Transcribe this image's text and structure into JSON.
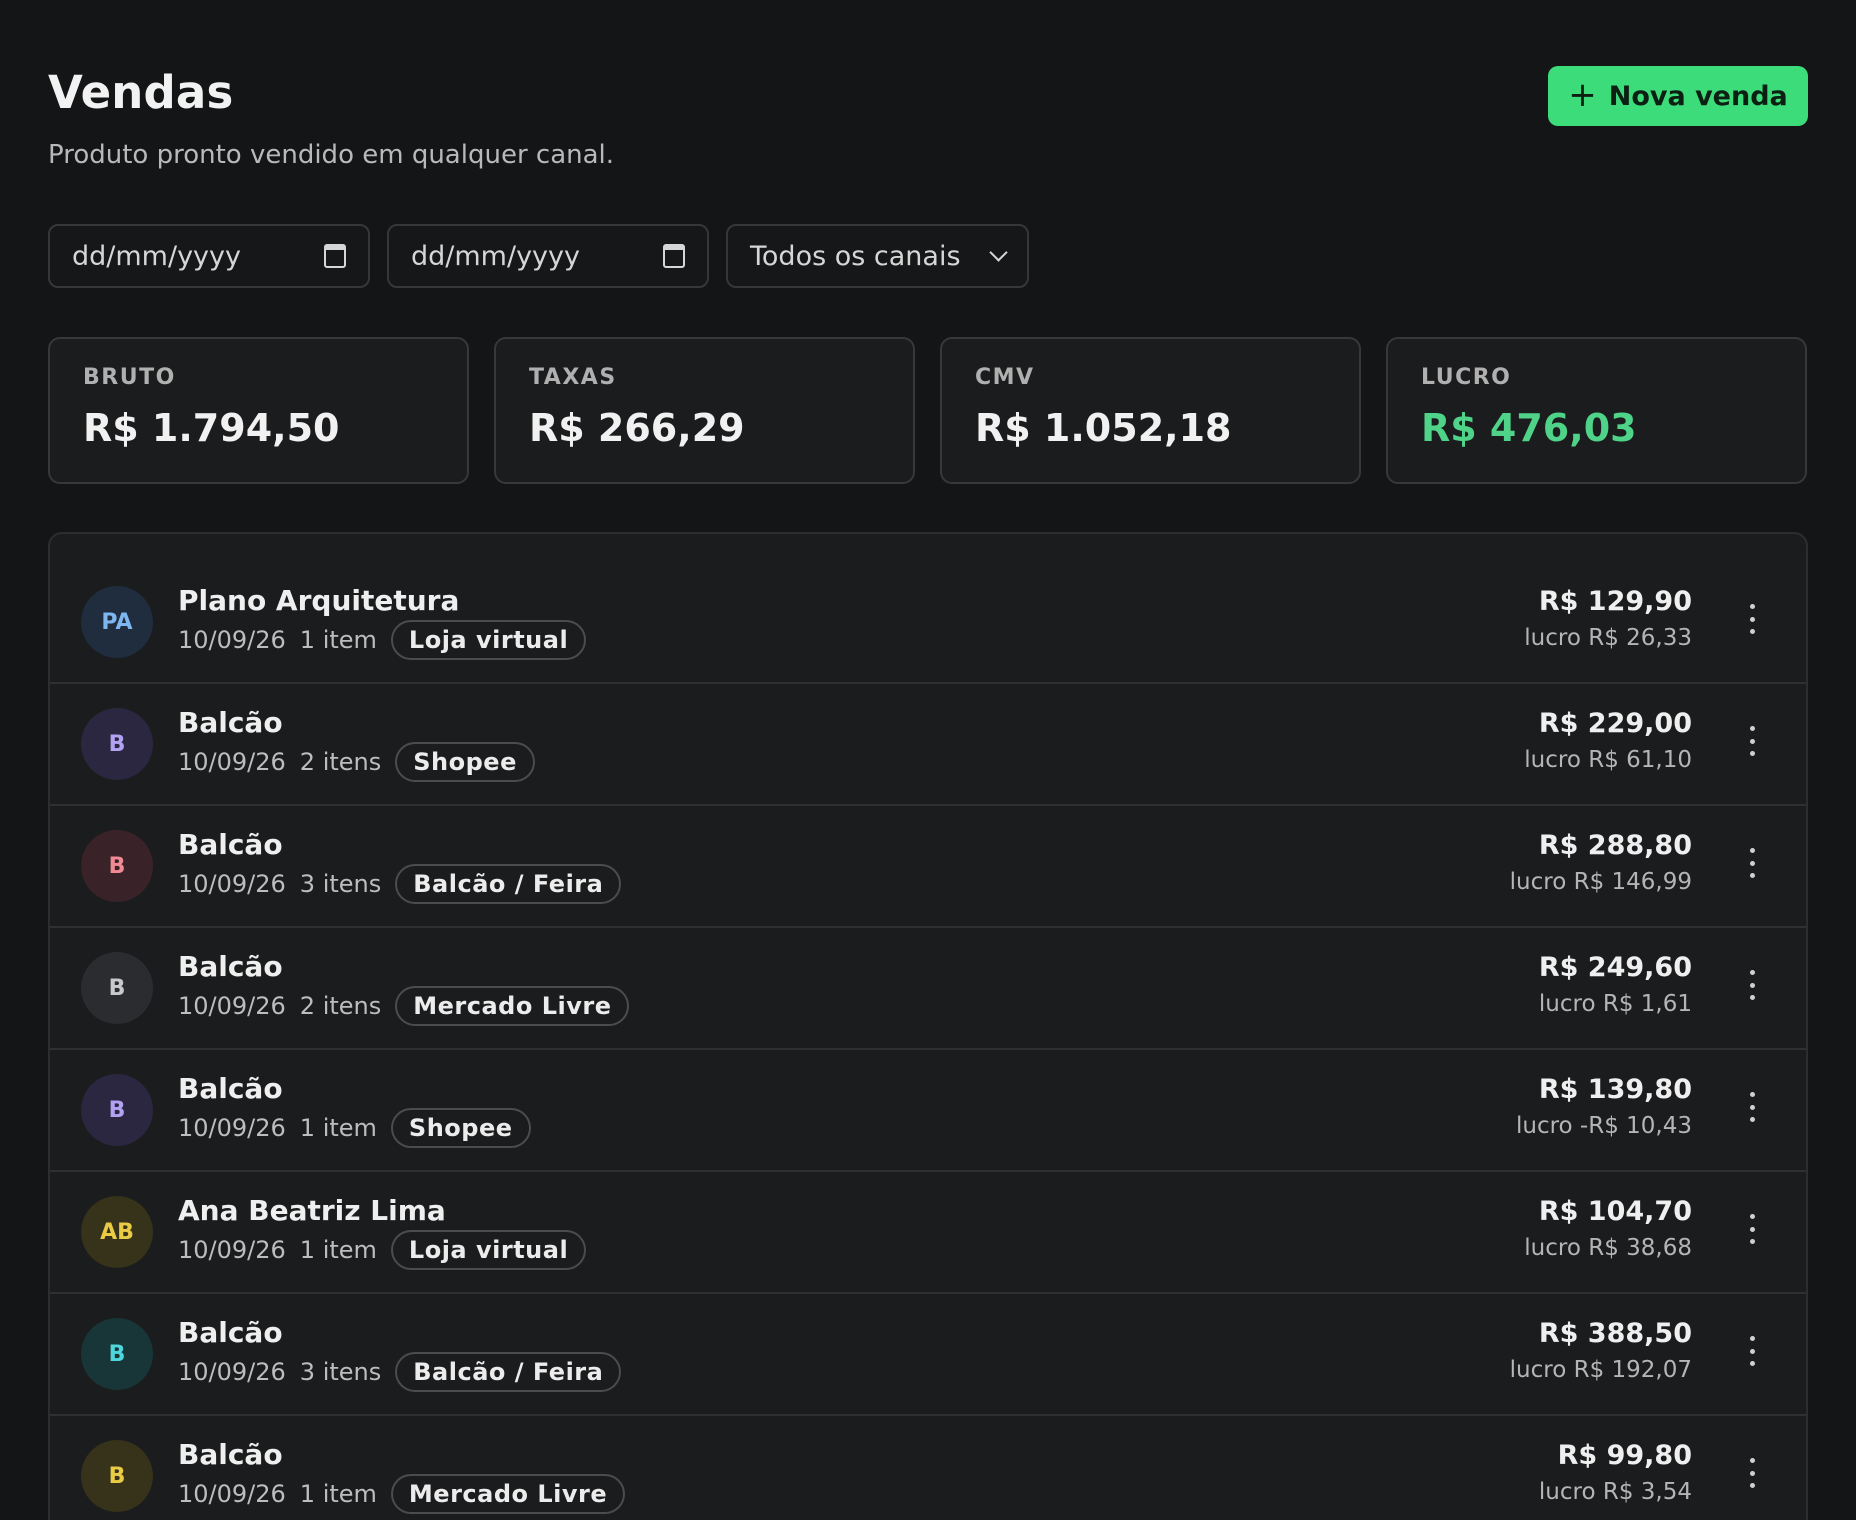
{
  "header": {
    "title": "Vendas",
    "subtitle": "Produto pronto vendido em qualquer canal.",
    "new_button_icon": "+",
    "new_button_label": "Nova venda"
  },
  "filters": {
    "date_from_placeholder": "dd/mm/yyyy",
    "date_to_placeholder": "dd/mm/yyyy",
    "channel_selected": "Todos os canais"
  },
  "stats": {
    "bruto": {
      "label": "BRUTO",
      "value": "R$ 1.794,50"
    },
    "taxas": {
      "label": "TAXAS",
      "value": "R$ 266,29"
    },
    "cmv": {
      "label": "CMV",
      "value": "R$ 1.052,18"
    },
    "lucro": {
      "label": "LUCRO",
      "value": "R$ 476,03"
    }
  },
  "colors": {
    "accent_green": "#3ddc7a",
    "profit_green": "#4fd389"
  },
  "sales": [
    {
      "initials": "PA",
      "name": "Plano Arquitetura",
      "date": "10/09/26",
      "items": "1 item",
      "channel": "Loja virtual",
      "amount": "R$ 129,90",
      "profit": "lucro R$ 26,33",
      "avatar_bg": "#1f2d3e",
      "avatar_fg": "#7eb6f0"
    },
    {
      "initials": "B",
      "name": "Balcão",
      "date": "10/09/26",
      "items": "2 itens",
      "channel": "Shopee",
      "amount": "R$ 229,00",
      "profit": "lucro R$ 61,10",
      "avatar_bg": "#2b2740",
      "avatar_fg": "#b3a2f2"
    },
    {
      "initials": "B",
      "name": "Balcão",
      "date": "10/09/26",
      "items": "3 itens",
      "channel": "Balcão / Feira",
      "amount": "R$ 288,80",
      "profit": "lucro R$ 146,99",
      "avatar_bg": "#3a2328",
      "avatar_fg": "#f08a94"
    },
    {
      "initials": "B",
      "name": "Balcão",
      "date": "10/09/26",
      "items": "2 itens",
      "channel": "Mercado Livre",
      "amount": "R$ 249,60",
      "profit": "lucro R$ 1,61",
      "avatar_bg": "#2a2c2f",
      "avatar_fg": "#c7c9cc"
    },
    {
      "initials": "B",
      "name": "Balcão",
      "date": "10/09/26",
      "items": "1 item",
      "channel": "Shopee",
      "amount": "R$ 139,80",
      "profit": "lucro -R$ 10,43",
      "avatar_bg": "#2b2740",
      "avatar_fg": "#b3a2f2"
    },
    {
      "initials": "AB",
      "name": "Ana Beatriz Lima",
      "date": "10/09/26",
      "items": "1 item",
      "channel": "Loja virtual",
      "amount": "R$ 104,70",
      "profit": "lucro R$ 38,68",
      "avatar_bg": "#37321a",
      "avatar_fg": "#eacb45"
    },
    {
      "initials": "B",
      "name": "Balcão",
      "date": "10/09/26",
      "items": "3 itens",
      "channel": "Balcão / Feira",
      "amount": "R$ 388,50",
      "profit": "lucro R$ 192,07",
      "avatar_bg": "#183538",
      "avatar_fg": "#4fd6dc"
    },
    {
      "initials": "B",
      "name": "Balcão",
      "date": "10/09/26",
      "items": "1 item",
      "channel": "Mercado Livre",
      "amount": "R$ 99,80",
      "profit": "lucro R$ 3,54",
      "avatar_bg": "#37321a",
      "avatar_fg": "#eacb45"
    }
  ]
}
